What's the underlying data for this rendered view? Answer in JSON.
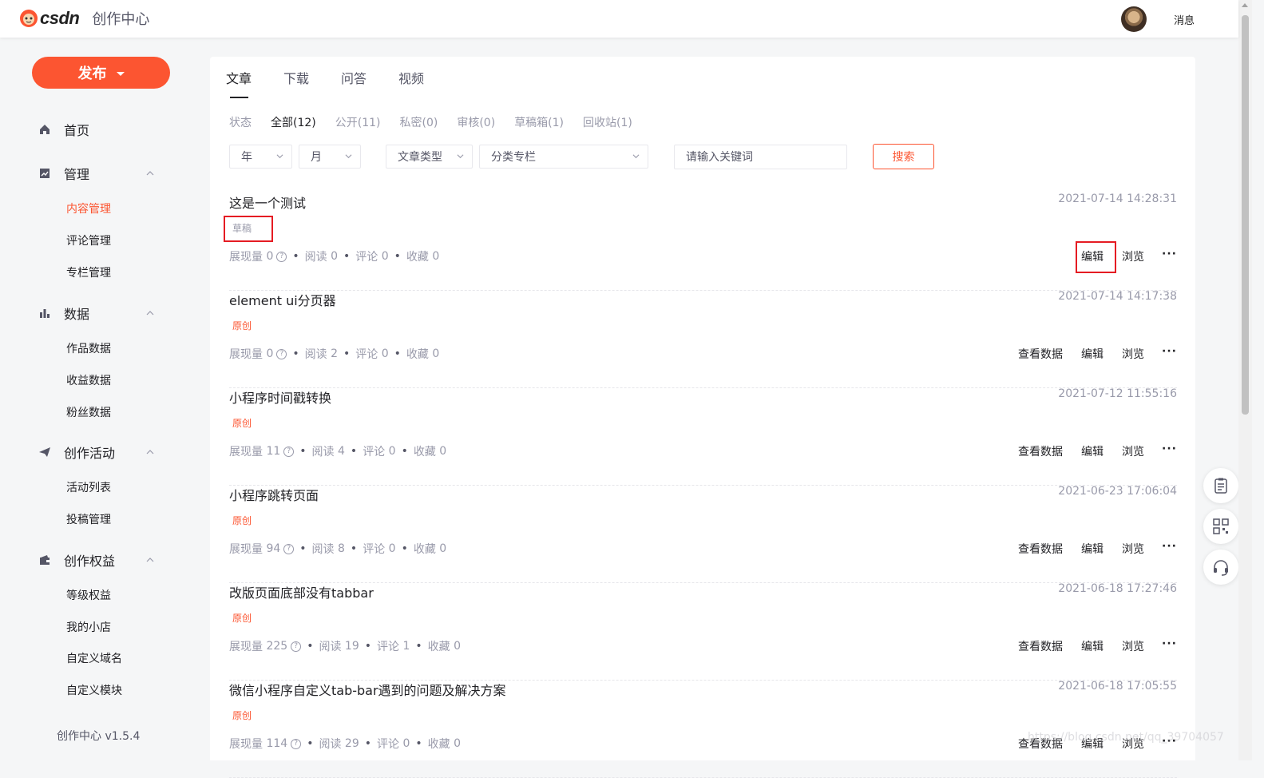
{
  "header": {
    "logo_text": "CSDN",
    "logo_sub": "创作中心",
    "message_label": "消息"
  },
  "sidebar": {
    "publish_label": "发布",
    "home": "首页",
    "sections": [
      {
        "label": "管理",
        "items": [
          "内容管理",
          "评论管理",
          "专栏管理"
        ]
      },
      {
        "label": "数据",
        "items": [
          "作品数据",
          "收益数据",
          "粉丝数据"
        ]
      },
      {
        "label": "创作活动",
        "items": [
          "活动列表",
          "投稿管理"
        ]
      },
      {
        "label": "创作权益",
        "items": [
          "等级权益",
          "我的小店",
          "自定义域名",
          "自定义模块"
        ]
      }
    ],
    "version": "创作中心 v1.5.4"
  },
  "tabs": [
    "文章",
    "下载",
    "问答",
    "视频"
  ],
  "status": {
    "label": "状态",
    "options": [
      "全部(12)",
      "公开(11)",
      "私密(0)",
      "审核(0)",
      "草稿箱(1)",
      "回收站(1)"
    ]
  },
  "filters": {
    "year": "年",
    "month": "月",
    "type": "文章类型",
    "column": "分类专栏",
    "keyword_placeholder": "请输入关键词",
    "search_label": "搜索"
  },
  "stat_labels": {
    "impressions": "展现量",
    "reads": "阅读",
    "comments": "评论",
    "favorites": "收藏",
    "help": "?"
  },
  "action_labels": {
    "data": "查看数据",
    "edit": "编辑",
    "view": "浏览",
    "more": "···"
  },
  "articles": [
    {
      "title": "这是一个测试",
      "time": "2021-07-14 14:28:31",
      "tag": "草稿",
      "impressions": "0",
      "reads": "0",
      "comments": "0",
      "favorites": "0"
    },
    {
      "title": "element ui分页器",
      "time": "2021-07-14 14:17:38",
      "tag": "原创",
      "impressions": "0",
      "reads": "2",
      "comments": "0",
      "favorites": "0"
    },
    {
      "title": "小程序时间戳转换",
      "time": "2021-07-12 11:55:16",
      "tag": "原创",
      "impressions": "11",
      "reads": "4",
      "comments": "0",
      "favorites": "0"
    },
    {
      "title": "小程序跳转页面",
      "time": "2021-06-23 17:06:04",
      "tag": "原创",
      "impressions": "94",
      "reads": "8",
      "comments": "0",
      "favorites": "0"
    },
    {
      "title": "改版页面底部没有tabbar",
      "time": "2021-06-18 17:27:46",
      "tag": "原创",
      "impressions": "225",
      "reads": "19",
      "comments": "1",
      "favorites": "0"
    },
    {
      "title": "微信小程序自定义tab-bar遇到的问题及解决方案",
      "time": "2021-06-18 17:05:55",
      "tag": "原创",
      "impressions": "114",
      "reads": "29",
      "comments": "0",
      "favorites": "0"
    }
  ],
  "watermark": "https://blog.csdn.net/qq_39704057",
  "colors": {
    "accent": "#fc5531",
    "highlight": "#e51c23"
  }
}
